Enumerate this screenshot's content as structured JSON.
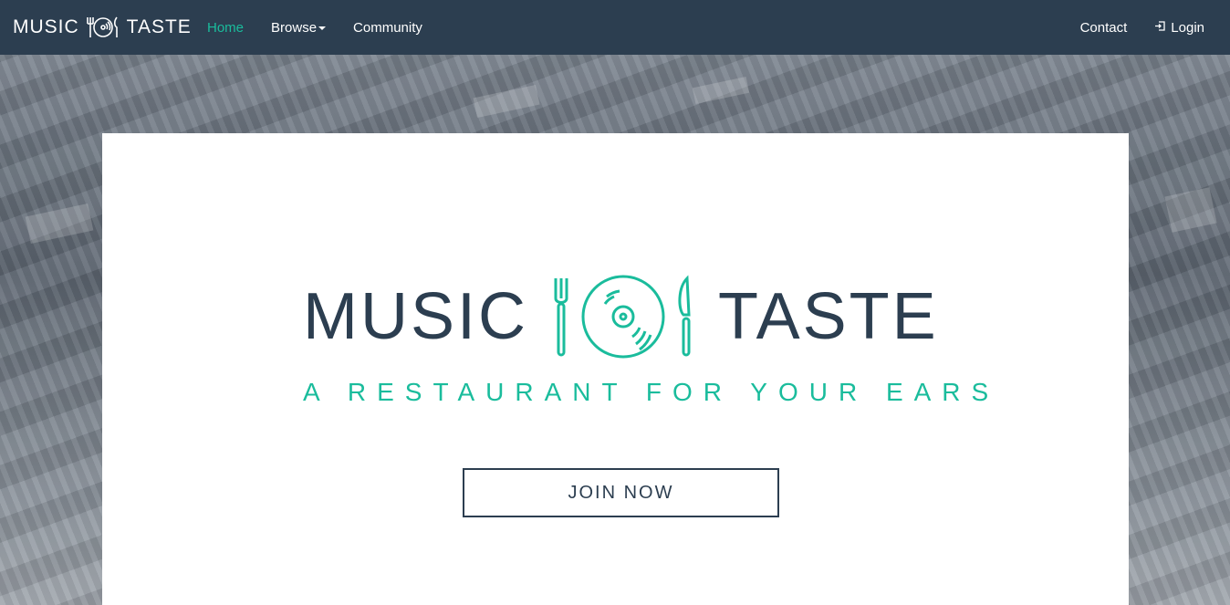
{
  "brand": {
    "word1": "MUSIC",
    "word2": "TASTE",
    "logo_icon": "fork-vinyl-knife-icon"
  },
  "nav": {
    "left": [
      {
        "label": "Home",
        "active": true
      },
      {
        "label": "Browse",
        "has_dropdown": true
      },
      {
        "label": "Community"
      }
    ],
    "right": [
      {
        "label": "Contact"
      },
      {
        "label": "Login",
        "icon": "login-icon"
      }
    ]
  },
  "hero": {
    "word1": "MUSIC",
    "word2": "TASTE",
    "tagline": "A RESTAURANT FOR YOUR EARS",
    "cta_label": "JOIN NOW"
  },
  "colors": {
    "navbar": "#2c3e50",
    "accent": "#1abc9c",
    "text_dark": "#2c3e50"
  }
}
